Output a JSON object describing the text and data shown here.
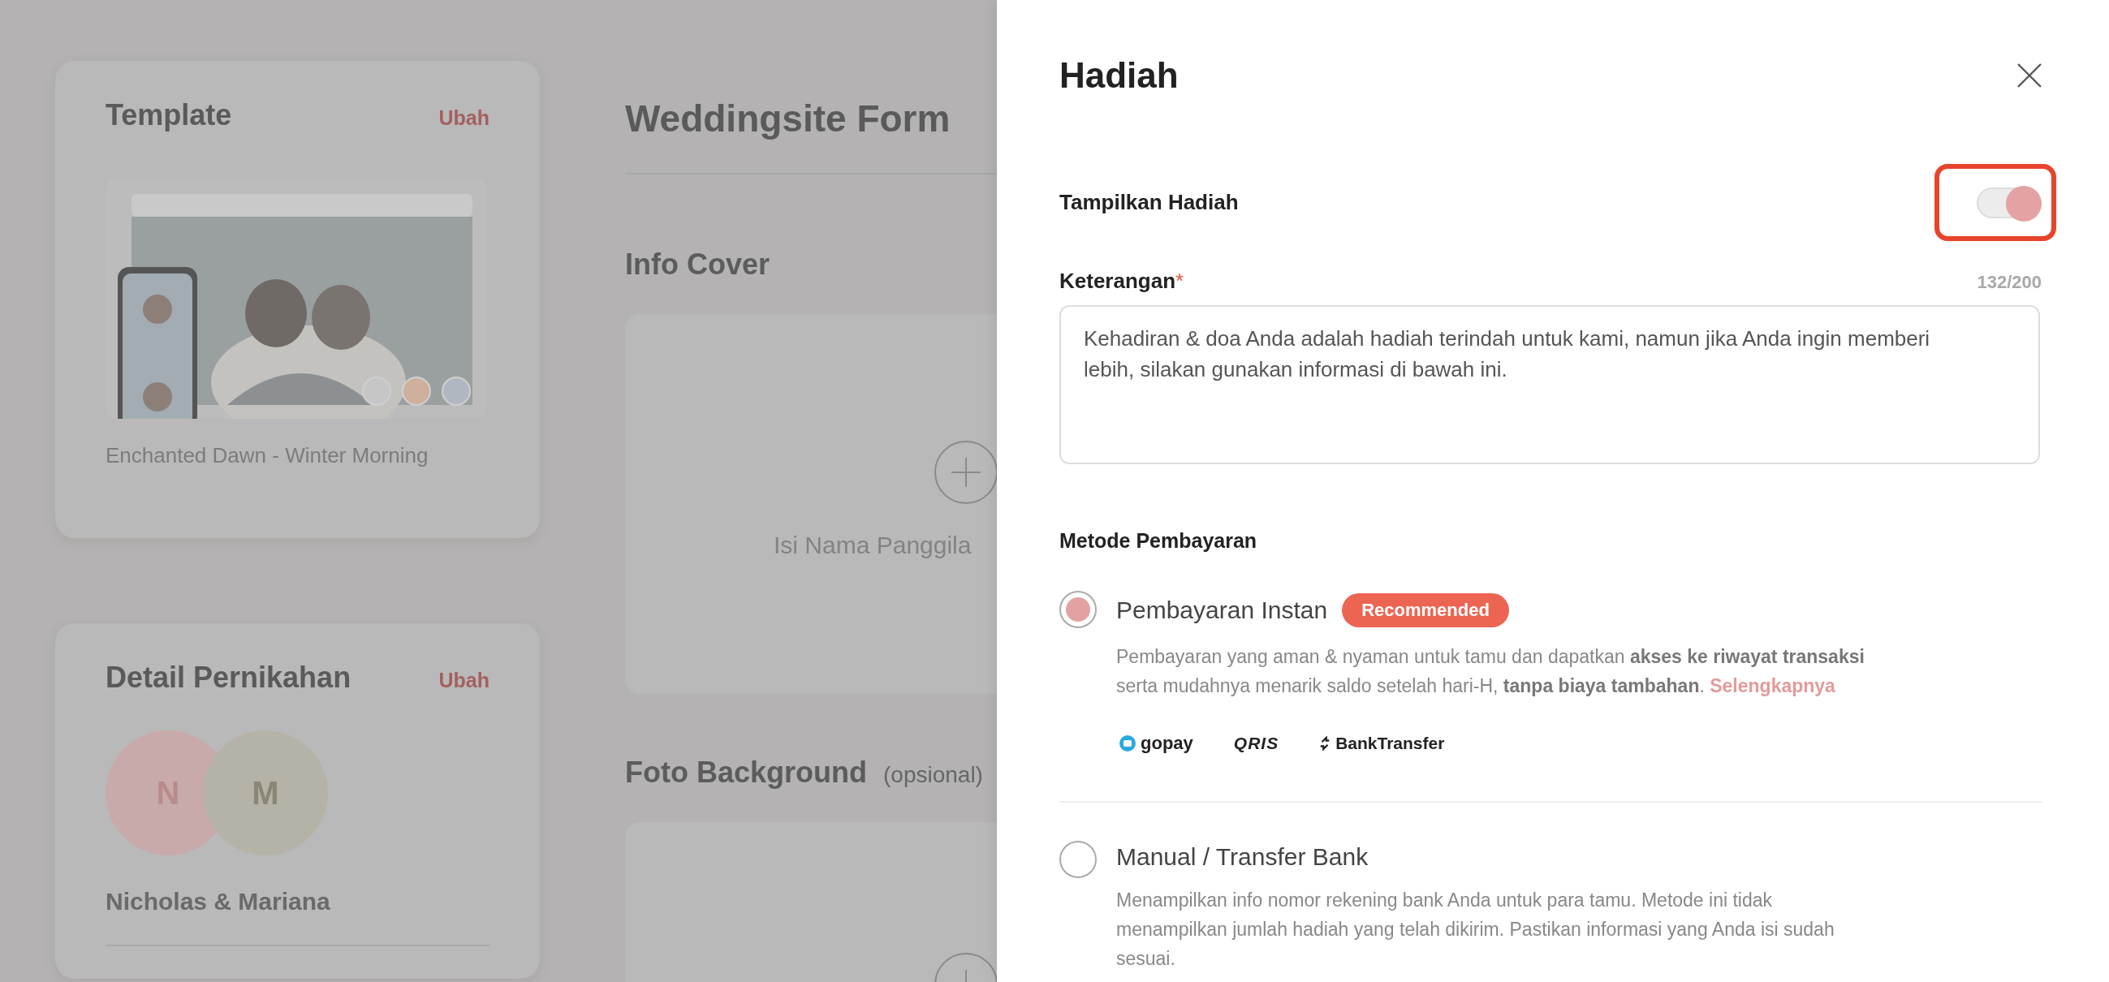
{
  "background": {
    "template_card": {
      "title": "Template",
      "action": "Ubah",
      "swatches": [
        {
          "color": "#c6c6c6",
          "selected": false
        },
        {
          "color": "#ceb09c",
          "selected": false
        },
        {
          "color": "#b0b7c1",
          "selected": false
        }
      ],
      "template_name": "Enchanted Dawn - Winter Morning"
    },
    "detail_card": {
      "title": "Detail Pernikahan",
      "action": "Ubah",
      "couple": [
        {
          "initial": "N",
          "color": "#c8aaaa"
        },
        {
          "initial": "M",
          "color": "#b5b3a8"
        }
      ],
      "names": "Nicholas & Mariana"
    },
    "form": {
      "title": "Weddingsite Form",
      "sections": [
        {
          "title": "Info Cover",
          "hint": "Isi Nama Panggila"
        },
        {
          "title": "Foto Background",
          "note": "(opsional)"
        }
      ]
    }
  },
  "drawer": {
    "title": "Hadiah",
    "toggle": {
      "label": "Tampilkan Hadiah",
      "on": true,
      "highlighted": true
    },
    "description_field": {
      "label": "Keterangan",
      "required_mark": "*",
      "counter": "132/200",
      "value": "Kehadiran & doa Anda adalah hadiah terindah untuk kami, namun jika Anda ingin memberi lebih, silakan gunakan informasi di bawah ini."
    },
    "payment": {
      "label": "Metode Pembayaran",
      "options": [
        {
          "title": "Pembayaran Instan",
          "badge": "Recommended",
          "selected": true,
          "description": "Pembayaran yang aman & nyaman untuk tamu dan dapatkan **akses ke riwayat transaksi** serta mudahnya menarik saldo setelah hari-H, **tanpa biaya tambahan**.",
          "link": "Selengkapnya",
          "logos": [
            {
              "kind": "gopay",
              "label": "gopay"
            },
            {
              "kind": "qris",
              "label": "QRIS"
            },
            {
              "kind": "bank",
              "label": "BankTransfer"
            }
          ]
        },
        {
          "title": "Manual / Transfer Bank",
          "selected": false,
          "description": "Menampilkan info nomor rekening bank Anda untuk para tamu. Metode ini tidak menampilkan jumlah hadiah yang telah dikirim. Pastikan informasi yang Anda isi sudah sesuai."
        }
      ]
    }
  }
}
